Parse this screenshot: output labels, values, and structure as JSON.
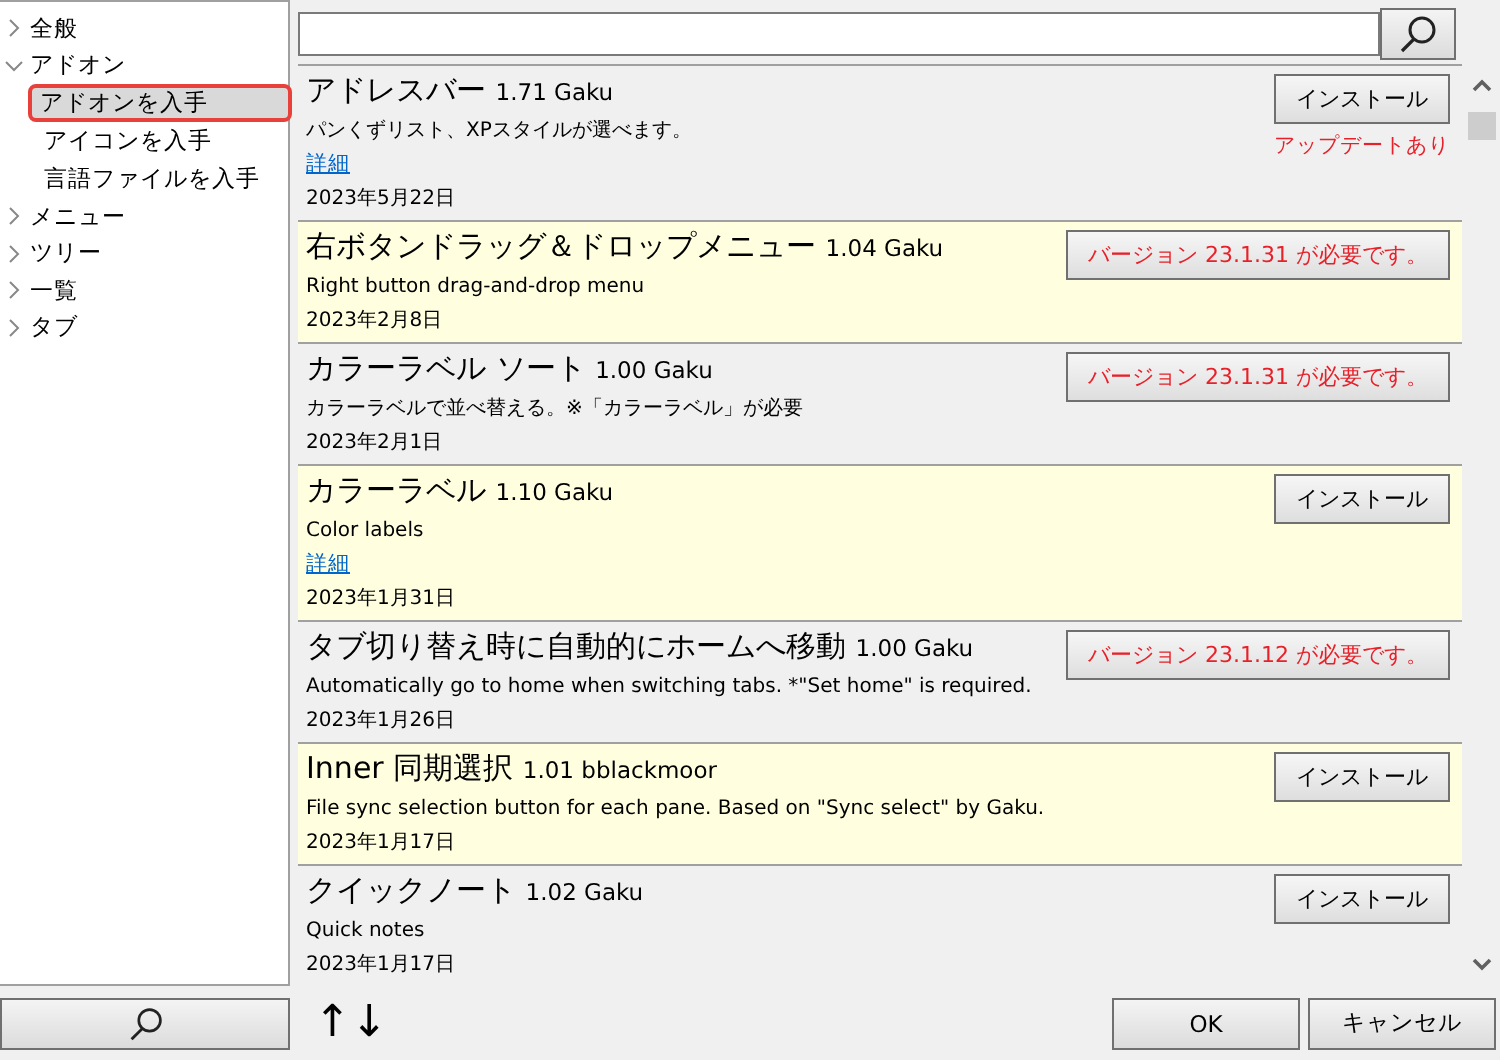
{
  "sidebar": {
    "items": [
      {
        "label": "全般",
        "expanded": false
      },
      {
        "label": "アドオン",
        "expanded": true,
        "children": [
          {
            "label": "アドオンを入手",
            "selected": true
          },
          {
            "label": "アイコンを入手",
            "selected": false
          },
          {
            "label": "言語ファイルを入手",
            "selected": false
          }
        ]
      },
      {
        "label": "メニュー",
        "expanded": false
      },
      {
        "label": "ツリー",
        "expanded": false
      },
      {
        "label": "一覧",
        "expanded": false
      },
      {
        "label": "タブ",
        "expanded": false
      }
    ]
  },
  "addons": [
    {
      "title": "アドレスバー",
      "version": "1.71 Gaku",
      "description": "パンくずリスト、XPスタイルが選べます。",
      "link": "詳細",
      "date": "2023年5月22日",
      "action": {
        "kind": "install",
        "label": "インストール"
      },
      "note": "アップデートあり"
    },
    {
      "title": "右ボタンドラッグ＆ドロップメニュー",
      "version": "1.04 Gaku",
      "description": "Right button drag-and-drop menu",
      "date": "2023年2月8日",
      "action": {
        "kind": "requires",
        "label": "バージョン 23.1.31 が必要です。"
      }
    },
    {
      "title": "カラーラベル ソート",
      "version": "1.00 Gaku",
      "description": "カラーラベルで並べ替える。※「カラーラベル」が必要",
      "date": "2023年2月1日",
      "action": {
        "kind": "requires",
        "label": "バージョン 23.1.31 が必要です。"
      }
    },
    {
      "title": "カラーラベル",
      "version": "1.10 Gaku",
      "description": "Color labels",
      "link": "詳細",
      "date": "2023年1月31日",
      "action": {
        "kind": "install",
        "label": "インストール"
      }
    },
    {
      "title": "タブ切り替え時に自動的にホームへ移動",
      "version": "1.00 Gaku",
      "description": "Automatically go to home when switching tabs. *\"Set home\" is required.",
      "date": "2023年1月26日",
      "action": {
        "kind": "requires",
        "label": "バージョン 23.1.12 が必要です。"
      }
    },
    {
      "title": "Inner 同期選択",
      "version": "1.01 bblackmoor",
      "description": "File sync selection button for each pane. Based on \"Sync select\" by Gaku.",
      "date": "2023年1月17日",
      "action": {
        "kind": "install",
        "label": "インストール"
      }
    },
    {
      "title": "クイックノート",
      "version": "1.02 Gaku",
      "description": "Quick notes",
      "date": "2023年1月17日",
      "action": {
        "kind": "install",
        "label": "インストール"
      }
    }
  ],
  "bottom": {
    "sort_label": "↑↓",
    "buttons": [
      "OK",
      "キャンセル"
    ]
  }
}
